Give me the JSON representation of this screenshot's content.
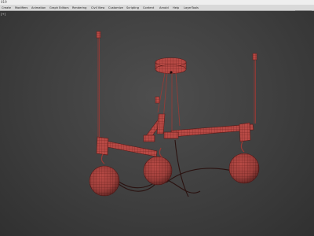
{
  "app": {
    "title": "019"
  },
  "menubar": {
    "items": [
      {
        "label": "Create"
      },
      {
        "label": "Modifiers"
      },
      {
        "label": "Animation"
      },
      {
        "label": "Graph Editors"
      },
      {
        "label": "Rendering"
      },
      {
        "label": "Civil View"
      },
      {
        "label": "Customize"
      },
      {
        "label": "Scripting"
      },
      {
        "label": "Content"
      },
      {
        "label": "Arnold"
      },
      {
        "label": "Help"
      },
      {
        "label": "LayerTools"
      }
    ],
    "search_icon": "search-icon"
  },
  "viewport": {
    "label": "[+]",
    "background_color": "#404040",
    "model_color": "#b84a45",
    "wire_color": "#5a1a18",
    "cable_color": "#2a1210"
  }
}
